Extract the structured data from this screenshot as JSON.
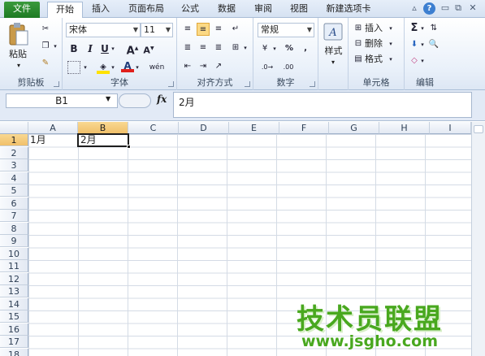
{
  "tabs": [
    "文件",
    "开始",
    "插入",
    "页面布局",
    "公式",
    "数据",
    "审阅",
    "视图",
    "新建选项卡"
  ],
  "ribbon": {
    "clipboard": {
      "label": "剪贴板",
      "paste": "粘贴"
    },
    "font": {
      "label": "字体",
      "name": "宋体",
      "size": "11"
    },
    "alignment": {
      "label": "对齐方式"
    },
    "number": {
      "label": "数字",
      "format": "常规"
    },
    "styles": {
      "label": "样式"
    },
    "cells": {
      "label": "单元格",
      "insert": "插入",
      "delete": "删除",
      "format": "格式"
    },
    "editing": {
      "label": "编辑"
    }
  },
  "formula_bar": {
    "name_box": "B1",
    "fx": "fx",
    "content": "2月"
  },
  "sheet": {
    "columns": [
      "A",
      "B",
      "C",
      "D",
      "E",
      "F",
      "G",
      "H",
      "I"
    ],
    "rows": [
      "1",
      "2",
      "3",
      "4",
      "5",
      "6",
      "7",
      "8",
      "9",
      "10",
      "11",
      "12",
      "13",
      "14",
      "15",
      "16",
      "17",
      "18"
    ],
    "selected_cell": "B1",
    "cells": {
      "A1": "1月",
      "B1": "2月"
    }
  },
  "watermark": {
    "title": "技术员联盟",
    "url": "www.jsgho.com"
  },
  "colors": {
    "file_tab": "#2a8a2e",
    "selection_header": "#f5c96e",
    "watermark": "#49a81f"
  }
}
